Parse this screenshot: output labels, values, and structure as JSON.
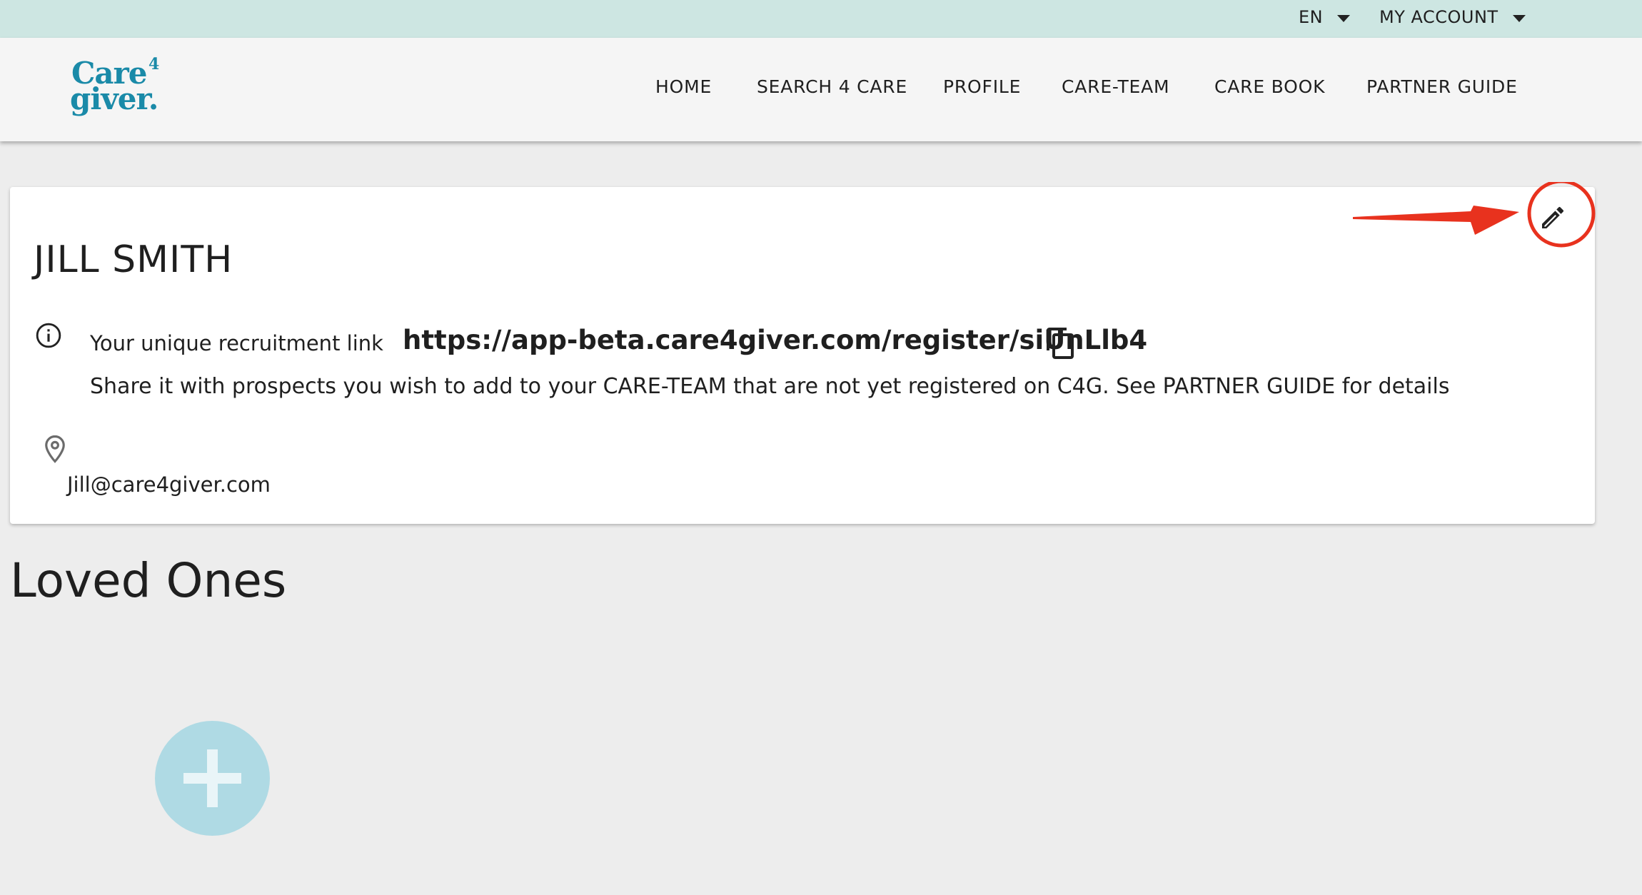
{
  "topbar": {
    "language": "EN",
    "account": "MY ACCOUNT"
  },
  "logo": {
    "line1": "Care",
    "sup": "4",
    "line2": "giver."
  },
  "nav": {
    "items": [
      {
        "label": "HOME"
      },
      {
        "label": "SEARCH 4 CARE"
      },
      {
        "label": "PROFILE"
      },
      {
        "label": "CARE-TEAM"
      },
      {
        "label": "CARE BOOK"
      },
      {
        "label": "PARTNER GUIDE"
      }
    ]
  },
  "profile": {
    "name": "JILL SMITH",
    "recruitment_label": "Your unique recruitment link",
    "recruitment_link": "https://app-beta.care4giver.com/register/siUnLlb4",
    "recruitment_description": "Share it with prospects you wish to add to your CARE-TEAM that are not yet registered on C4G. See PARTNER GUIDE for details",
    "email": "Jill@care4giver.com"
  },
  "loved_ones": {
    "title": "Loved Ones"
  },
  "icons": {
    "edit": "pencil-icon",
    "info": "info-icon",
    "copy": "copy-icon",
    "location": "location-pin-icon",
    "add": "plus-icon",
    "dropdown": "caret-down-icon"
  },
  "colors": {
    "topbar": "#cde6e2",
    "brand": "#1a8aa8",
    "add_button": "#afdae4",
    "annotation": "#e8321e"
  }
}
